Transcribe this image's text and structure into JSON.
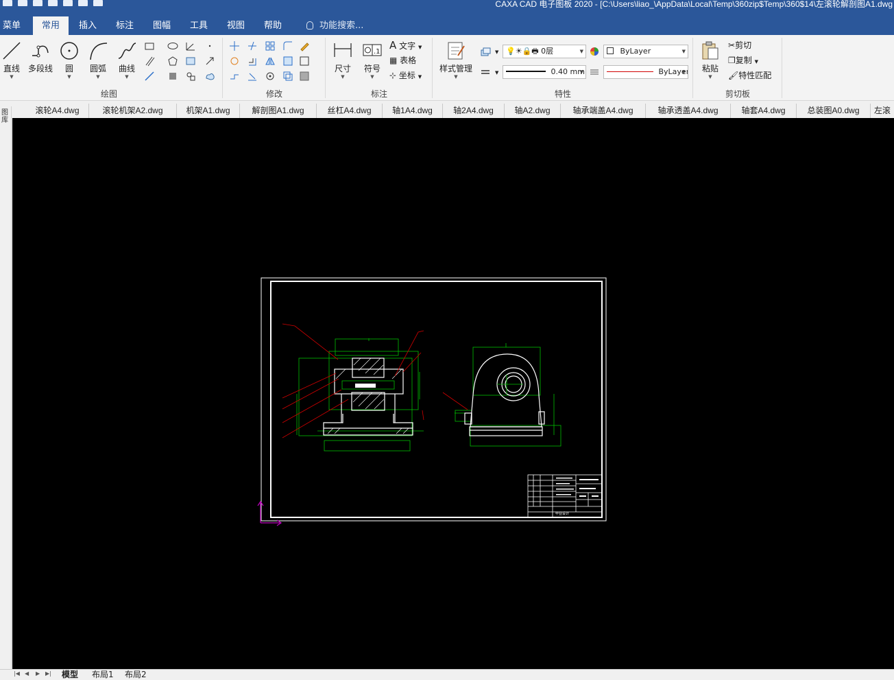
{
  "window": {
    "title": "CAXA CAD 电子图板 2020 - [C:\\Users\\liao_\\AppData\\Local\\Temp\\360zip$Temp\\360$14\\左滚轮解剖图A1.dwg"
  },
  "ribbon_tabs": [
    {
      "label": "菜单"
    },
    {
      "label": "常用"
    },
    {
      "label": "插入"
    },
    {
      "label": "标注"
    },
    {
      "label": "图幅"
    },
    {
      "label": "工具"
    },
    {
      "label": "视图"
    },
    {
      "label": "帮助"
    }
  ],
  "search": {
    "placeholder": "功能搜索..."
  },
  "groups": {
    "draw": {
      "label": "绘图",
      "buttons": [
        "直线",
        "多段线",
        "圆",
        "圆弧",
        "曲线"
      ]
    },
    "modify": {
      "label": "修改"
    },
    "annotate": {
      "label": "标注",
      "buttons": [
        "尺寸",
        "符号"
      ],
      "small": [
        "文字",
        "表格",
        "坐标"
      ]
    },
    "properties": {
      "label": "特性",
      "style_manager": "样式管理",
      "layer_value": "0层",
      "color_value": "ByLayer",
      "lineweight_value": "0.40 mm",
      "linetype_value": "ByLayer"
    },
    "clipboard": {
      "label": "剪切板",
      "paste": "粘贴",
      "small": [
        "剪切",
        "复制",
        "特性匹配"
      ]
    }
  },
  "doc_tabs": [
    "滚轮A4.dwg",
    "滚轮机架A2.dwg",
    "机架A1.dwg",
    "解剖图A1.dwg",
    "丝杠A4.dwg",
    "轴1A4.dwg",
    "轴2A4.dwg",
    "轴A2.dwg",
    "轴承端盖A4.dwg",
    "轴承透盖A4.dwg",
    "轴套A4.dwg",
    "总装图A0.dwg",
    "左滚"
  ],
  "left_strip": {
    "label": "图库"
  },
  "layout_tabs": [
    "模型",
    "布局1",
    "布局2"
  ],
  "drawing": {
    "title_block_text": "毕业设计"
  },
  "colors": {
    "accent": "#2b579a",
    "canvas": "#000000",
    "frame": "#ffffff",
    "geometry_green": "#00c000",
    "leader_red": "#d00000",
    "ucs_magenta": "#c000c0"
  }
}
